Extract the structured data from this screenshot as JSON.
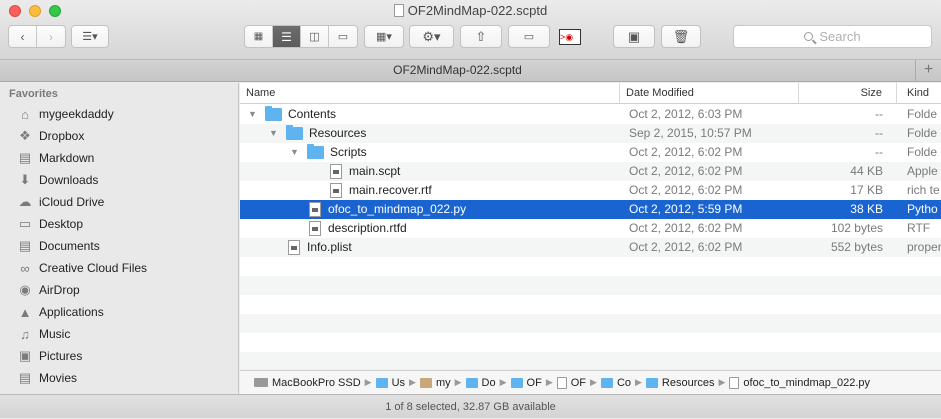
{
  "window": {
    "title": "OF2MindMap-022.scptd"
  },
  "toolbar": {
    "search_placeholder": "Search"
  },
  "tab": {
    "title": "OF2MindMap-022.scptd",
    "add_label": "+"
  },
  "sidebar": {
    "heading": "Favorites",
    "items": [
      {
        "label": "mygeekdaddy",
        "icon": "home-icon"
      },
      {
        "label": "Dropbox",
        "icon": "dropbox-icon"
      },
      {
        "label": "Markdown",
        "icon": "folder-icon"
      },
      {
        "label": "Downloads",
        "icon": "downloads-icon"
      },
      {
        "label": "iCloud Drive",
        "icon": "cloud-icon"
      },
      {
        "label": "Desktop",
        "icon": "desktop-icon"
      },
      {
        "label": "Documents",
        "icon": "documents-icon"
      },
      {
        "label": "Creative Cloud Files",
        "icon": "creative-cloud-icon"
      },
      {
        "label": "AirDrop",
        "icon": "airdrop-icon"
      },
      {
        "label": "Applications",
        "icon": "applications-icon"
      },
      {
        "label": "Music",
        "icon": "music-icon"
      },
      {
        "label": "Pictures",
        "icon": "pictures-icon"
      },
      {
        "label": "Movies",
        "icon": "movies-icon"
      }
    ]
  },
  "columns": {
    "name": "Name",
    "date": "Date Modified",
    "size": "Size",
    "kind": "Kind"
  },
  "files": [
    {
      "name": "Contents",
      "date": "Oct 2, 2012, 6:03 PM",
      "size": "--",
      "kind": "Folde",
      "type": "folder",
      "level": 0,
      "expanded": true
    },
    {
      "name": "Resources",
      "date": "Sep 2, 2015, 10:57 PM",
      "size": "--",
      "kind": "Folde",
      "type": "folder",
      "level": 1,
      "expanded": true
    },
    {
      "name": "Scripts",
      "date": "Oct 2, 2012, 6:02 PM",
      "size": "--",
      "kind": "Folde",
      "type": "folder",
      "level": 2,
      "expanded": true
    },
    {
      "name": "main.scpt",
      "date": "Oct 2, 2012, 6:02 PM",
      "size": "44 KB",
      "kind": "Apple",
      "type": "file",
      "level": 3
    },
    {
      "name": "main.recover.rtf",
      "date": "Oct 2, 2012, 6:02 PM",
      "size": "17 KB",
      "kind": "rich te",
      "type": "file",
      "level": 3
    },
    {
      "name": "ofoc_to_mindmap_022.py",
      "date": "Oct 2, 2012, 5:59 PM",
      "size": "38 KB",
      "kind": "Pytho",
      "type": "file",
      "level": 2,
      "selected": true
    },
    {
      "name": "description.rtfd",
      "date": "Oct 2, 2012, 6:02 PM",
      "size": "102 bytes",
      "kind": "RTF",
      "type": "file",
      "level": 2
    },
    {
      "name": "Info.plist",
      "date": "Oct 2, 2012, 6:02 PM",
      "size": "552 bytes",
      "kind": "proper",
      "type": "file",
      "level": 1
    }
  ],
  "pathbar": [
    {
      "label": "MacBookPro SSD",
      "icon": "drive"
    },
    {
      "label": "Us",
      "icon": "folder"
    },
    {
      "label": "my",
      "icon": "home"
    },
    {
      "label": "Do",
      "icon": "folder"
    },
    {
      "label": "OF",
      "icon": "folder"
    },
    {
      "label": "OF",
      "icon": "file"
    },
    {
      "label": "Co",
      "icon": "folder"
    },
    {
      "label": "Resources",
      "icon": "folder"
    },
    {
      "label": "ofoc_to_mindmap_022.py",
      "icon": "file"
    }
  ],
  "status": {
    "text": "1 of 8 selected, 32.87 GB available"
  },
  "colors": {
    "selection": "#1a64d1",
    "folder": "#5fb3ee"
  }
}
